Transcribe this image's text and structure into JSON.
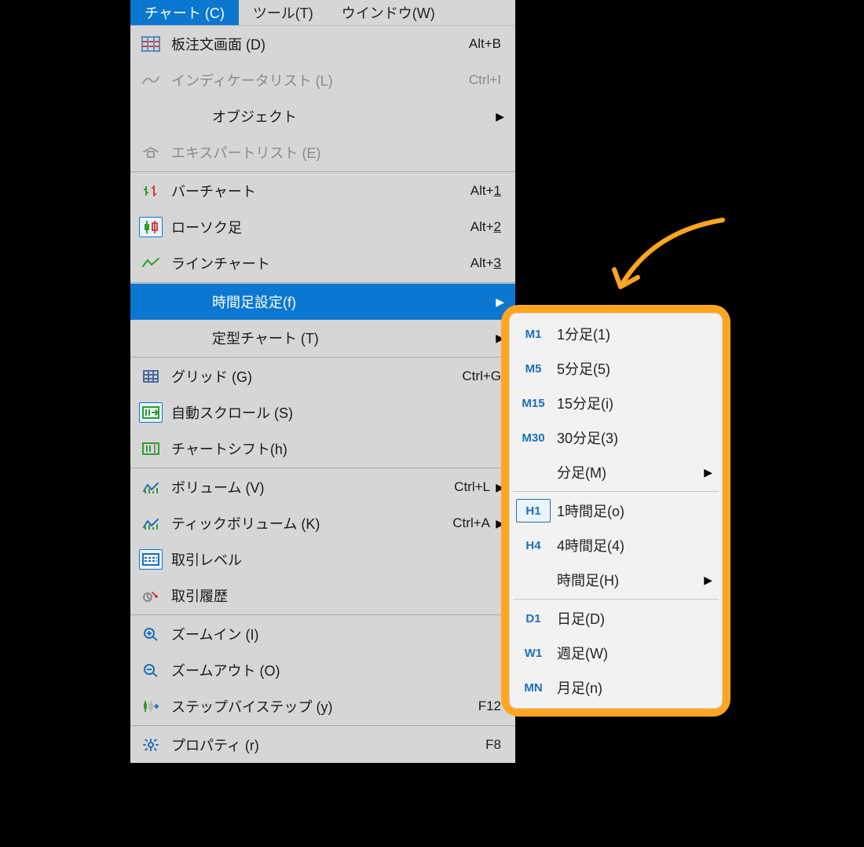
{
  "menubar": {
    "items": [
      {
        "label": "チャート (C)"
      },
      {
        "label": "ツール(T)"
      },
      {
        "label": "ウインドウ(W)"
      }
    ]
  },
  "dropdown": {
    "groups": [
      [
        {
          "icon": "dom-order-icon",
          "label": "板注文画面 (D)",
          "shortcut": "Alt+B",
          "disabled": false
        },
        {
          "icon": "indicator-icon",
          "label": "インディケータリスト (L)",
          "shortcut": "Ctrl+I",
          "disabled": true
        },
        {
          "icon": "",
          "label": "オブジェクト",
          "shortcut": "",
          "submenu": true
        },
        {
          "icon": "expert-icon",
          "label": "エキスパートリスト (E)",
          "shortcut": "",
          "disabled": true
        }
      ],
      [
        {
          "icon": "bar-chart-icon",
          "label": "バーチャート",
          "shortcut": "Alt+1"
        },
        {
          "icon": "candle-icon",
          "label": "ローソク足",
          "shortcut": "Alt+2",
          "boxed": true
        },
        {
          "icon": "line-chart-icon",
          "label": "ラインチャート",
          "shortcut": "Alt+3"
        }
      ],
      [
        {
          "icon": "",
          "label": "時間足設定(f)",
          "shortcut": "",
          "submenu": true,
          "highlight": true
        },
        {
          "icon": "",
          "label": "定型チャート (T)",
          "shortcut": "",
          "submenu": true
        }
      ],
      [
        {
          "icon": "grid-icon",
          "label": "グリッド (G)",
          "shortcut": "Ctrl+G"
        },
        {
          "icon": "autoscroll-icon",
          "label": "自動スクロール (S)",
          "shortcut": "",
          "boxed": true
        },
        {
          "icon": "chartshift-icon",
          "label": "チャートシフト(h)",
          "shortcut": ""
        }
      ],
      [
        {
          "icon": "volume-icon",
          "label": "ボリューム (V)",
          "shortcut": "Ctrl+L",
          "submenu": true
        },
        {
          "icon": "tickvolume-icon",
          "label": "ティックボリューム (K)",
          "shortcut": "Ctrl+A",
          "submenu": true
        },
        {
          "icon": "tradelevel-icon",
          "label": "取引レベル",
          "shortcut": "",
          "boxed": true
        },
        {
          "icon": "history-icon",
          "label": "取引履歴",
          "shortcut": ""
        }
      ],
      [
        {
          "icon": "zoomin-icon",
          "label": "ズームイン (I)",
          "shortcut": ""
        },
        {
          "icon": "zoomout-icon",
          "label": "ズームアウト (O)",
          "shortcut": ""
        },
        {
          "icon": "step-icon",
          "label": "ステップバイステップ (y)",
          "shortcut": "F12"
        }
      ],
      [
        {
          "icon": "properties-icon",
          "label": "プロパティ (r)",
          "shortcut": "F8"
        }
      ]
    ]
  },
  "submenu": {
    "groups": [
      [
        {
          "tf": "M1",
          "label": "1分足(1)"
        },
        {
          "tf": "M5",
          "label": "5分足(5)"
        },
        {
          "tf": "M15",
          "label": "15分足(i)"
        },
        {
          "tf": "M30",
          "label": "30分足(3)"
        },
        {
          "tf": "",
          "label": "分足(M)",
          "submenu": true
        }
      ],
      [
        {
          "tf": "H1",
          "label": "1時間足(o)",
          "selected": true
        },
        {
          "tf": "H4",
          "label": "4時間足(4)"
        },
        {
          "tf": "",
          "label": "時間足(H)",
          "submenu": true
        }
      ],
      [
        {
          "tf": "D1",
          "label": "日足(D)"
        },
        {
          "tf": "W1",
          "label": "週足(W)"
        },
        {
          "tf": "MN",
          "label": "月足(n)"
        }
      ]
    ]
  },
  "colors": {
    "accent": "#0b77d1",
    "highlight": "#ffa51f"
  }
}
